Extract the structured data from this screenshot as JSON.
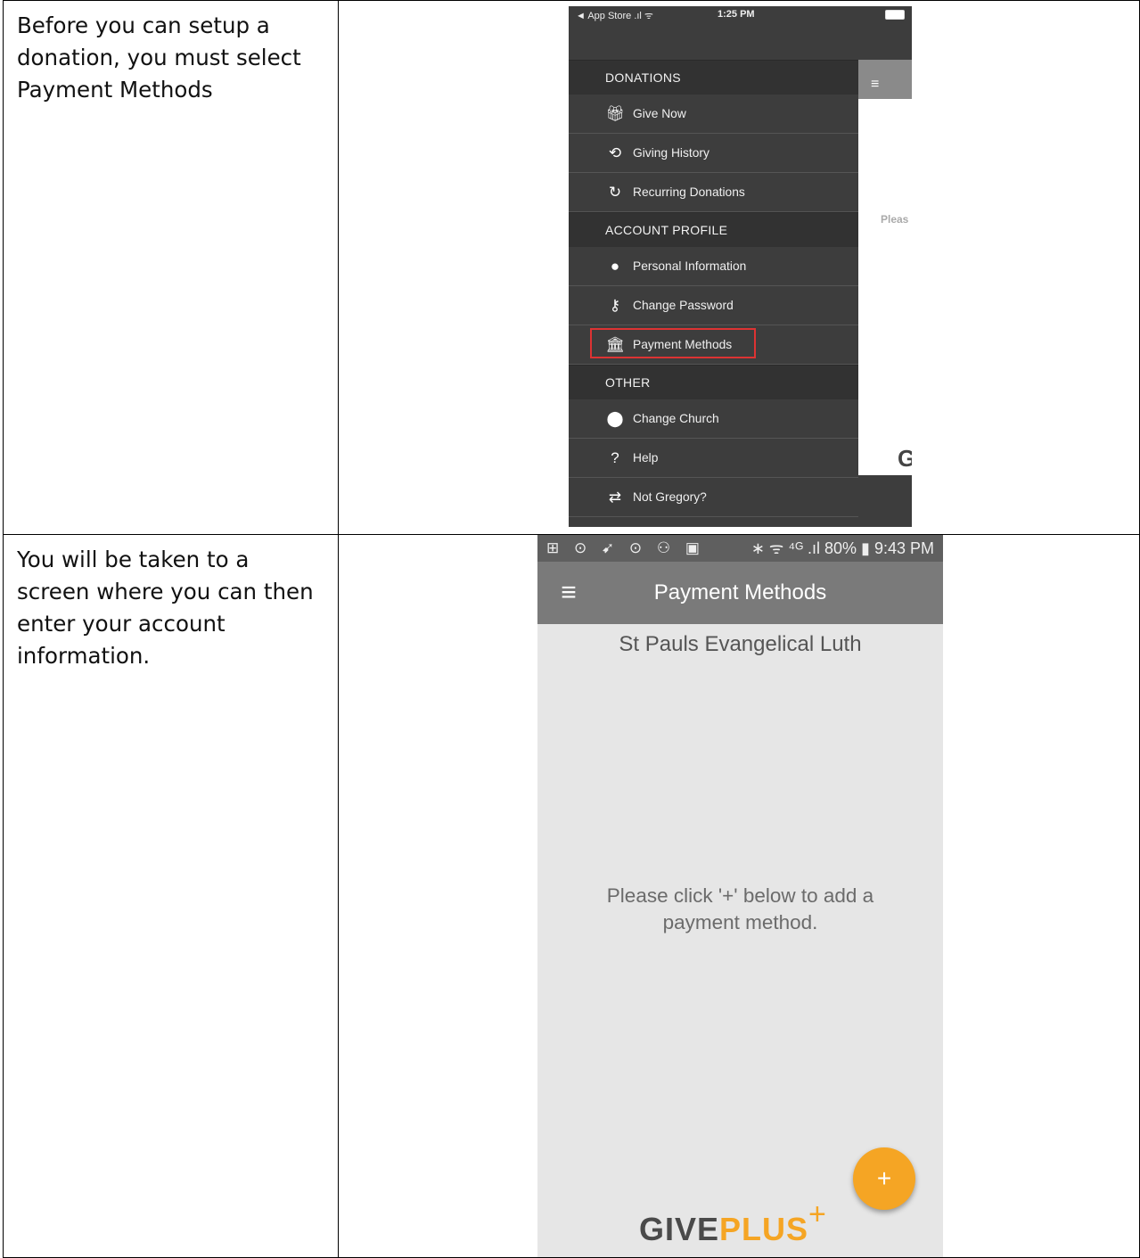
{
  "rows": [
    {
      "text": "Before you can setup a donation, you must select Payment Methods"
    },
    {
      "text": "You will be taken to a screen where you can then enter your account information."
    }
  ],
  "ios": {
    "status": {
      "carrier": "◄ App Store .ıl ᯤ",
      "time": "1:25 PM"
    },
    "sections": [
      {
        "title": "DONATIONS",
        "items": [
          {
            "label": "Give Now",
            "icon": "gift-icon"
          },
          {
            "label": "Giving History",
            "icon": "history-icon"
          },
          {
            "label": "Recurring Donations",
            "icon": "refresh-icon"
          }
        ]
      },
      {
        "title": "ACCOUNT PROFILE",
        "items": [
          {
            "label": "Personal Information",
            "icon": "user-icon"
          },
          {
            "label": "Change Password",
            "icon": "key-icon"
          },
          {
            "label": "Payment Methods",
            "icon": "bank-icon"
          }
        ]
      },
      {
        "title": "OTHER",
        "items": [
          {
            "label": "Change Church",
            "icon": "location-icon"
          },
          {
            "label": "Help",
            "icon": "help-icon"
          },
          {
            "label": "Not Gregory?",
            "icon": "swap-icon"
          }
        ]
      }
    ],
    "panel": {
      "menu": "≡",
      "peek_text": "Pleas",
      "peek_letter": "G"
    }
  },
  "android": {
    "status": {
      "left": "⊞ ⊙ ➹ ⊙ ⚇ ▣",
      "right": "∗ ᯤ ⁴ᴳ .ıl 80% ▮ 9:43 PM"
    },
    "title": "Payment Methods",
    "church": "St Pauls Evangelical Luth",
    "empty_message": "Please click '+' below to add a\npayment method.",
    "fab": "+",
    "logo": {
      "give": "GIVE",
      "plus": "PLUS",
      "cross": "+"
    }
  }
}
